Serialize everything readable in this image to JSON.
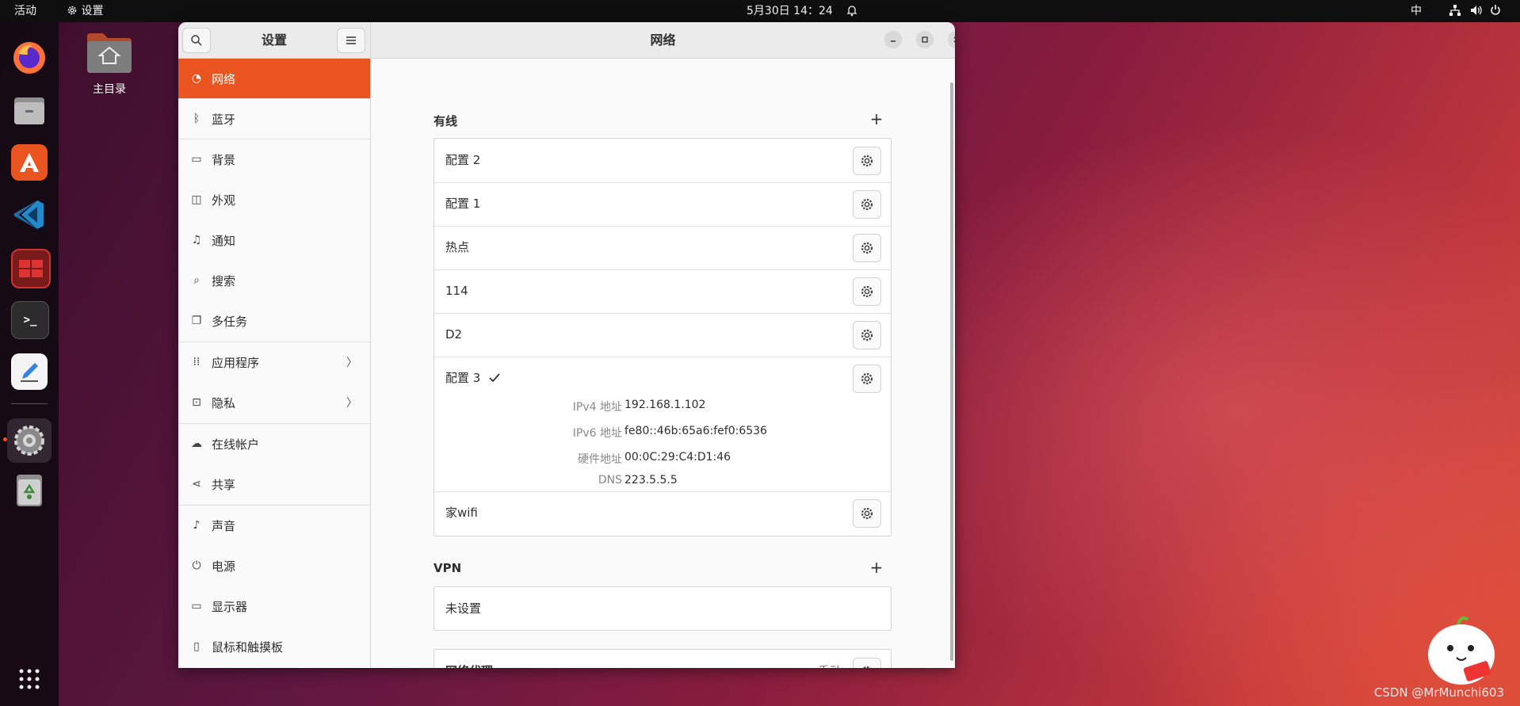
{
  "topbar": {
    "activities": "活动",
    "app_name": "设置",
    "datetime": "5月30日  14：24",
    "input_method": "中"
  },
  "desktop": {
    "home_folder_label": "主目录"
  },
  "dock": {
    "apps": [
      "firefox",
      "files",
      "app-center",
      "vscode",
      "screenshot-tool",
      "terminal",
      "text-editor",
      "settings",
      "trash",
      "show-apps"
    ]
  },
  "window": {
    "sidebar_title": "设置",
    "main_title": "网络"
  },
  "sidebar": {
    "items": [
      {
        "label": "网络",
        "icon": "network-icon"
      },
      {
        "label": "蓝牙",
        "icon": "bluetooth-icon"
      },
      {
        "label": "背景",
        "icon": "background-icon"
      },
      {
        "label": "外观",
        "icon": "appearance-icon"
      },
      {
        "label": "通知",
        "icon": "bell-icon"
      },
      {
        "label": "搜索",
        "icon": "search-icon"
      },
      {
        "label": "多任务",
        "icon": "multitask-icon"
      },
      {
        "label": "应用程序",
        "icon": "apps-grid-icon"
      },
      {
        "label": "隐私",
        "icon": "lock-icon"
      },
      {
        "label": "在线帐户",
        "icon": "cloud-icon"
      },
      {
        "label": "共享",
        "icon": "share-icon"
      },
      {
        "label": "声音",
        "icon": "music-note-icon"
      },
      {
        "label": "电源",
        "icon": "power-icon"
      },
      {
        "label": "显示器",
        "icon": "display-icon"
      },
      {
        "label": "鼠标和触摸板",
        "icon": "mouse-icon"
      }
    ]
  },
  "wired": {
    "title": "有线",
    "connections": [
      "配置 2",
      "配置 1",
      "热点",
      "114",
      "D2"
    ],
    "active": {
      "name": "配置 3",
      "details": [
        {
          "key": "IPv4 地址",
          "value": "192.168.1.102"
        },
        {
          "key": "IPv6 地址",
          "value": "fe80::46b:65a6:fef0:6536"
        },
        {
          "key": "硬件地址",
          "value": "00:0C:29:C4:D1:46"
        },
        {
          "key": "DNS",
          "value": "223.5.5.5"
        }
      ]
    },
    "last": "家wifi"
  },
  "vpn": {
    "title": "VPN",
    "empty_label": "未设置"
  },
  "proxy": {
    "title": "网络代理",
    "status": "手动"
  },
  "watermark": "CSDN @MrMunchi603"
}
